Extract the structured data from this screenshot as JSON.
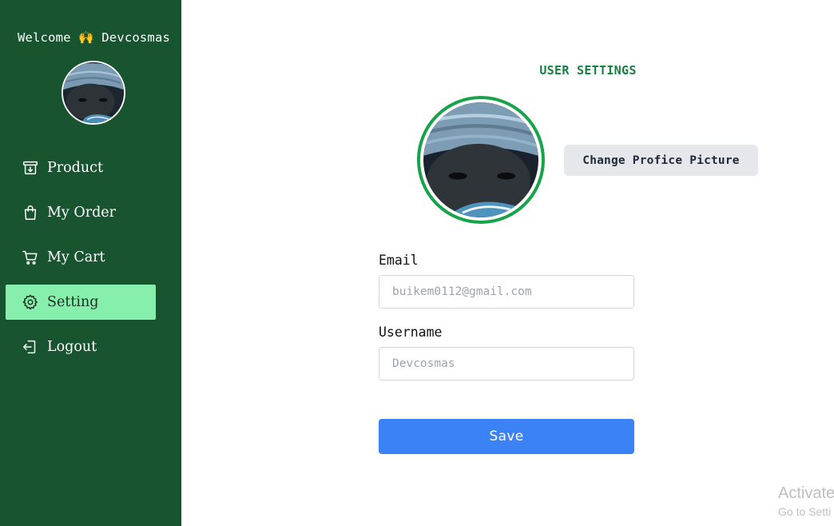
{
  "sidebar": {
    "welcome_text": "Welcome 🙌 Devcosmas",
    "items": [
      {
        "label": "Product",
        "icon": "archive-box-icon",
        "active": false
      },
      {
        "label": "My Order",
        "icon": "shopping-bag-icon",
        "active": false
      },
      {
        "label": "My Cart",
        "icon": "shopping-cart-icon",
        "active": false
      },
      {
        "label": "Setting",
        "icon": "gear-icon",
        "active": true
      },
      {
        "label": "Logout",
        "icon": "logout-icon",
        "active": false
      }
    ],
    "background": "#185430",
    "active_background": "#86efac"
  },
  "main": {
    "title": "USER SETTINGS",
    "change_picture_label": "Change Profice Picture",
    "email": {
      "label": "Email",
      "placeholder": "buikem0112@gmail.com",
      "value": ""
    },
    "username": {
      "label": "Username",
      "placeholder": "Devcosmas",
      "value": ""
    },
    "save_label": "Save",
    "accent": "#15803d",
    "button_color": "#3b82f6"
  },
  "watermark": {
    "line1": "Activate",
    "line2": "Go to Setti"
  }
}
